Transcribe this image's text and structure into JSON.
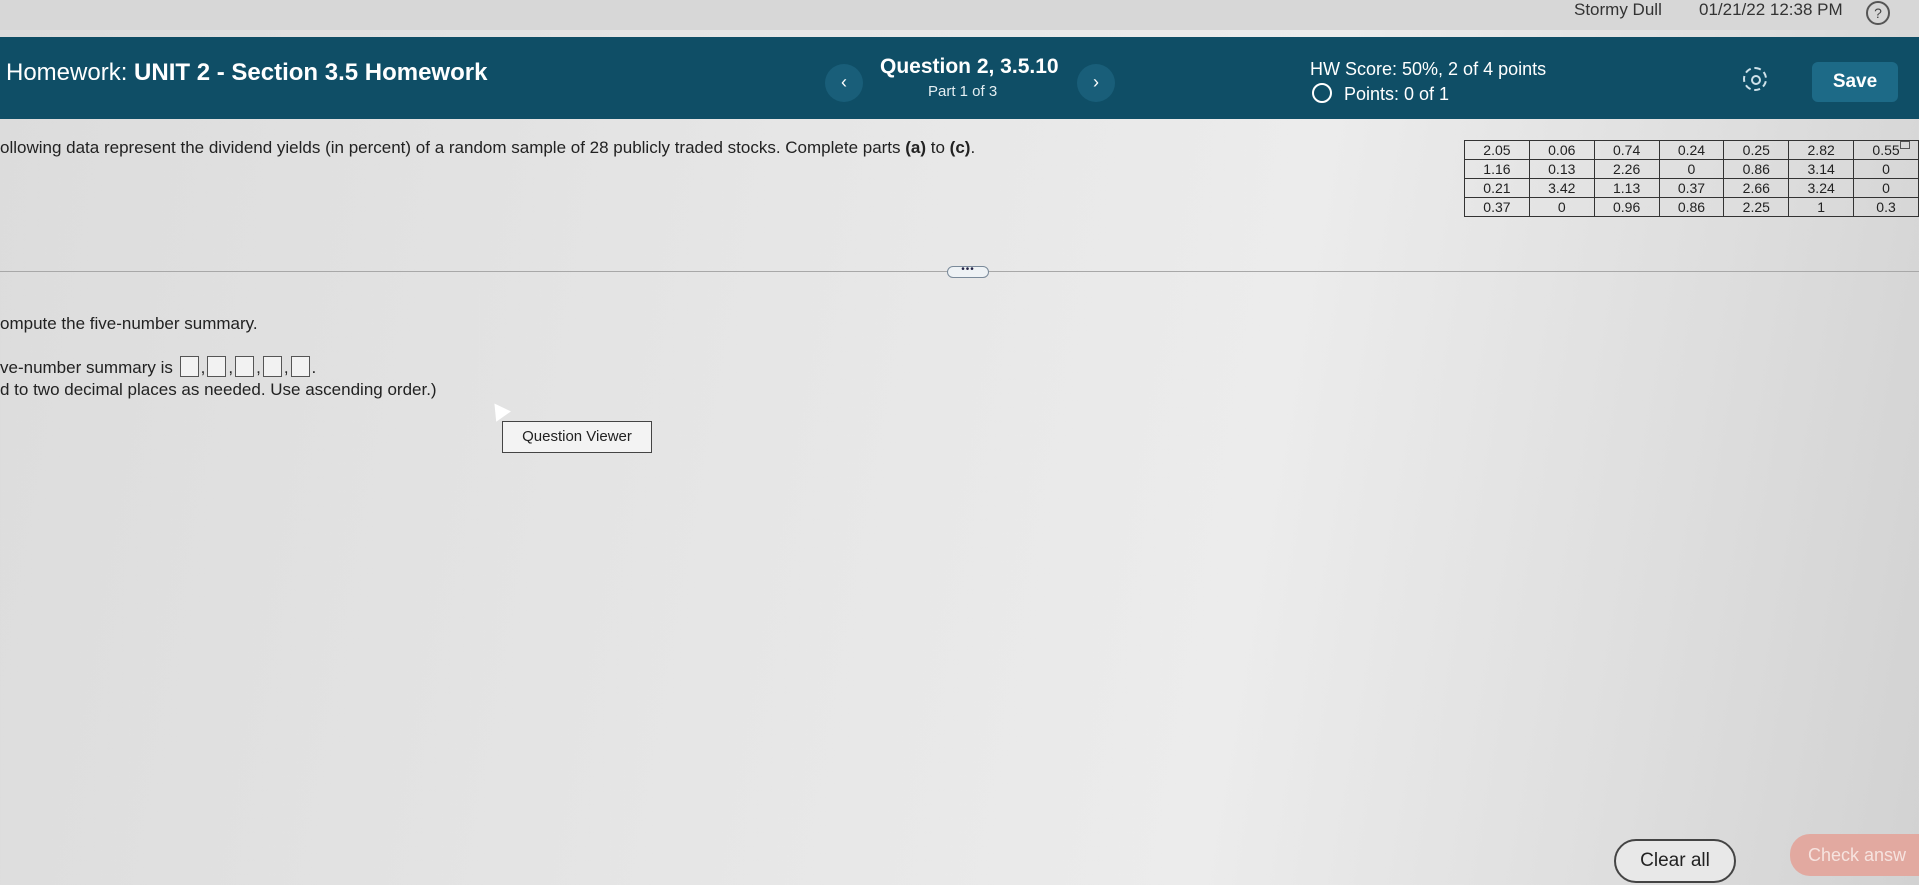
{
  "system_bar": {
    "user": "Stormy Dull",
    "datetime": "01/21/22 12:38 PM",
    "help_icon": "?"
  },
  "header": {
    "homework_prefix": "Homework:",
    "homework_title": "UNIT 2 - Section 3.5 Homework",
    "prev_icon": "‹",
    "next_icon": "›",
    "question": "Question 2, 3.5.10",
    "part": "Part 1 of 3",
    "hw_score": "HW Score: 50%, 2 of 4 points",
    "points": "Points: 0 of 1",
    "save_label": "Save"
  },
  "problem": {
    "prompt_start": "ollowing data represent  the dividend yields (in percent) of a random sample of 28 publicly traded stocks. Complete parts ",
    "part_a": "(a)",
    "to": " to ",
    "part_c": "(c)",
    "period": ".",
    "data_rows": [
      [
        "2.05",
        "0.06",
        "0.74",
        "0.24",
        "0.25",
        "2.82",
        "0.55"
      ],
      [
        "1.16",
        "0.13",
        "2.26",
        "0",
        "0.86",
        "3.14",
        "0"
      ],
      [
        "0.21",
        "3.42",
        "1.13",
        "0.37",
        "2.66",
        "3.24",
        "0"
      ],
      [
        "0.37",
        "0",
        "0.96",
        "0.86",
        "2.25",
        "1",
        "0.3"
      ]
    ],
    "expand_label": "•••"
  },
  "question_part": {
    "instruction": "ompute the five-number summary.",
    "summary_prefix": "ve-number summary is",
    "hint": "d to two decimal places as needed. Use ascending order.)",
    "viewer_label": "Question Viewer"
  },
  "footer": {
    "clear_all": "Clear all",
    "check_answer": "Check answ"
  },
  "colors": {
    "header_bg": "#0f4e66",
    "save_bg": "#1d6a87",
    "check_answer_bg": "#e2a9a0"
  }
}
